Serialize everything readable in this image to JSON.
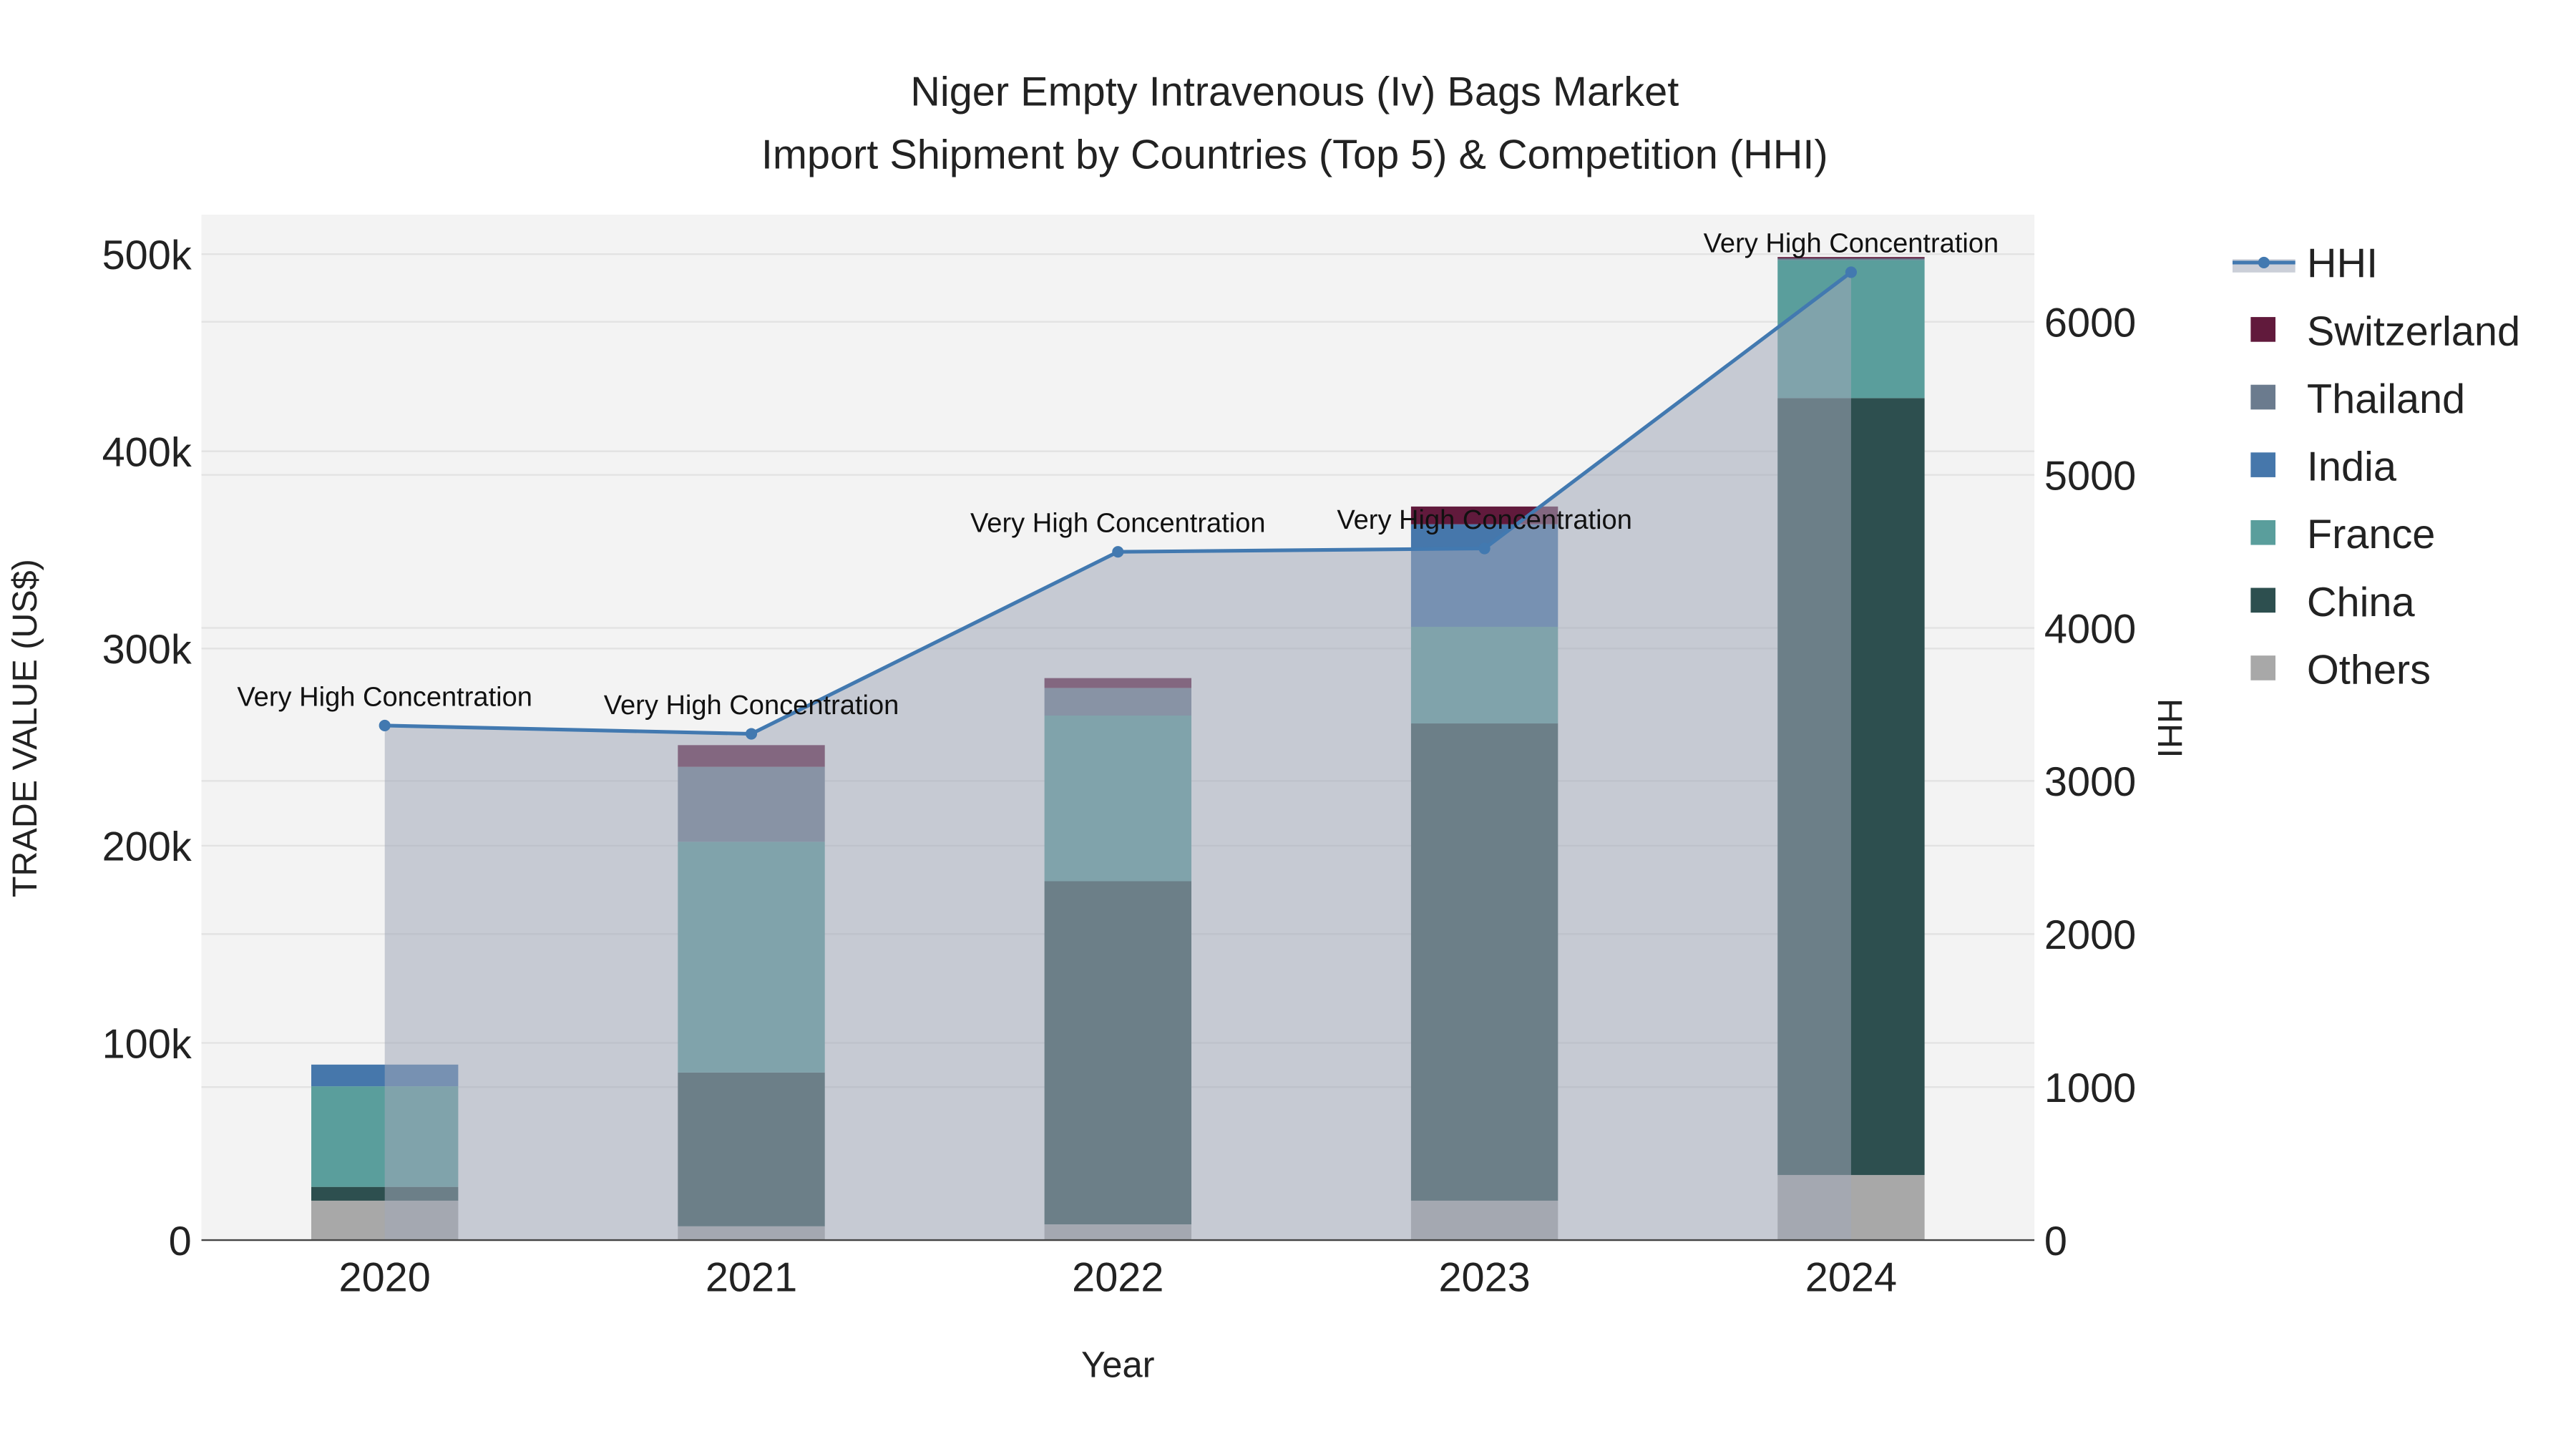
{
  "chart_data": {
    "type": "bar",
    "title": "Niger Empty Intravenous (Iv) Bags Market",
    "subtitle": "Import Shipment by Countries (Top 5) & Competition (HHI)",
    "xlabel": "Year",
    "ylabel": "TRADE VALUE (US$)",
    "y2label": "HHI",
    "ylim": [
      0,
      520000
    ],
    "y2lim": [
      0,
      6700
    ],
    "yticks": [
      0,
      100000,
      200000,
      300000,
      400000,
      500000
    ],
    "ytick_labels": [
      "0",
      "100k",
      "200k",
      "300k",
      "400k",
      "500k"
    ],
    "y2ticks": [
      0,
      1000,
      2000,
      3000,
      4000,
      5000,
      6000
    ],
    "y2tick_labels": [
      "0",
      "1000",
      "2000",
      "3000",
      "4000",
      "5000",
      "6000"
    ],
    "categories": [
      "2020",
      "2021",
      "2022",
      "2023",
      "2024"
    ],
    "series": [
      {
        "name": "Others",
        "color": "#a8a8a8",
        "values": [
          20000,
          7000,
          8000,
          20000,
          33000
        ]
      },
      {
        "name": "China",
        "color": "#2d4f4f",
        "values": [
          7000,
          78000,
          174000,
          242000,
          394000
        ]
      },
      {
        "name": "France",
        "color": "#5a9e9c",
        "values": [
          51000,
          117000,
          84000,
          49000,
          70000
        ]
      },
      {
        "name": "India",
        "color": "#4677ab",
        "values": [
          11000,
          0,
          0,
          52000,
          0
        ]
      },
      {
        "name": "Thailand",
        "color": "#6b7b8e",
        "values": [
          0,
          38000,
          14000,
          0,
          1000
        ]
      },
      {
        "name": "Switzerland",
        "color": "#611a3c",
        "values": [
          0,
          11000,
          5000,
          9000,
          500
        ]
      }
    ],
    "hhi": {
      "name": "HHI",
      "color": "#4279b0",
      "values": [
        3362,
        3308,
        4497,
        4519,
        6324
      ],
      "annotations": [
        "Very High Concentration",
        "Very High Concentration",
        "Very High Concentration",
        "Very High Concentration",
        "Very High Concentration"
      ]
    },
    "legend": {
      "position": "right",
      "entries": [
        "HHI",
        "Switzerland",
        "Thailand",
        "India",
        "France",
        "China",
        "Others"
      ]
    },
    "grid": true
  }
}
